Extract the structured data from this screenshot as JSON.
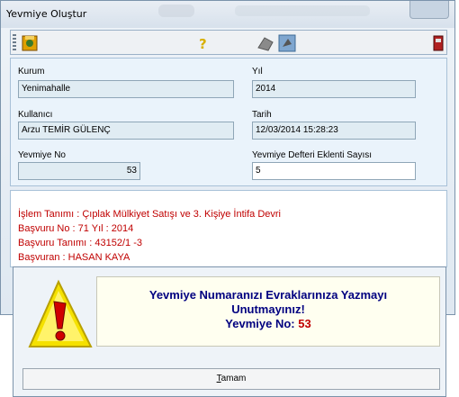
{
  "window": {
    "title": "Yevmiye Oluştur"
  },
  "toolbar": {
    "icons": [
      "save-icon",
      "help-icon",
      "tools-icon",
      "exit-icon"
    ]
  },
  "form": {
    "kurum_label": "Kurum",
    "kurum_value": "Yenimahalle",
    "yil_label": "Yıl",
    "yil_value": "2014",
    "kullanici_label": "Kullanıcı",
    "kullanici_value": "Arzu TEMİR GÜLENÇ",
    "tarih_label": "Tarih",
    "tarih_value": "12/03/2014 15:28:23",
    "yevmiye_no_label": "Yevmiye No",
    "yevmiye_no_value": "53",
    "ek_sayisi_label": "Yevmiye Defteri Eklenti Sayısı",
    "ek_sayisi_value": "5"
  },
  "info": {
    "line1": "İşlem Tanımı : Çıplak Mülkiyet Satışı ve 3. Kişiye İntifa Devri",
    "line2": "Başvuru No : 71   Yıl : 2014",
    "line3": "Başvuru Tanımı : 43152/1 -3",
    "line4": "Başvuran : HASAN KAYA"
  },
  "dialog": {
    "line1": "Yevmiye Numaranızı Evraklarınıza Yazmayı",
    "line2": "Unutmayınız!",
    "line3_label": "Yevmiye No: ",
    "line3_value": "53",
    "ok_first": "T",
    "ok_rest": "amam"
  },
  "colors": {
    "info_text": "#c00000",
    "dialog_text": "#000080",
    "accent": "#7b93ab"
  }
}
